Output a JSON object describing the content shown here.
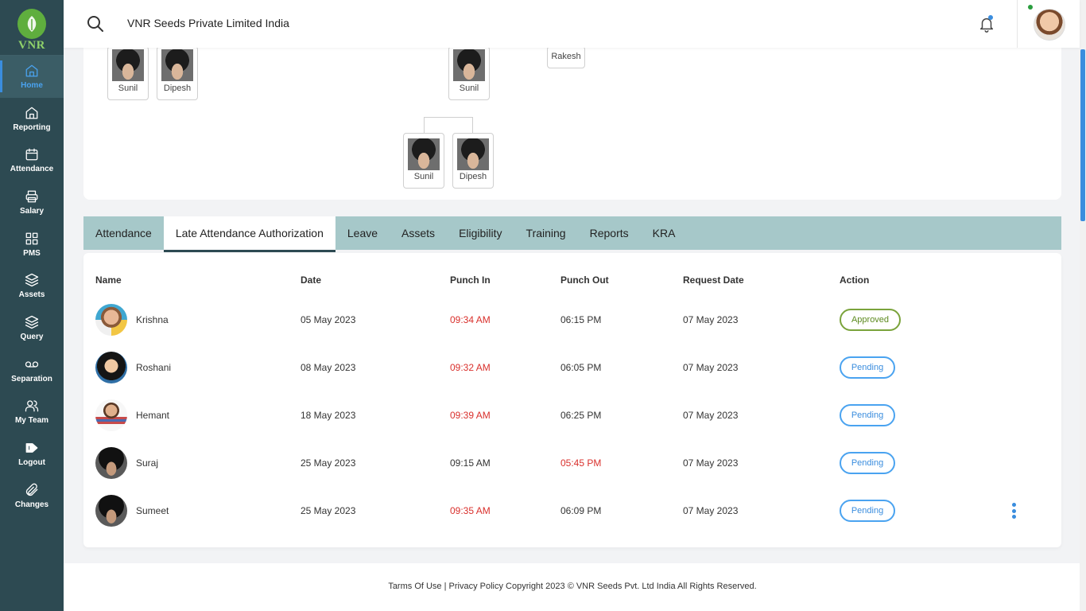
{
  "brand": {
    "logo_text": "VNR"
  },
  "sidebar": {
    "items": [
      {
        "label": "Home",
        "icon": "home-icon"
      },
      {
        "label": "Reporting",
        "icon": "home-icon"
      },
      {
        "label": "Attendance",
        "icon": "calendar-icon"
      },
      {
        "label": "Salary",
        "icon": "printer-icon"
      },
      {
        "label": "PMS",
        "icon": "grid-icon"
      },
      {
        "label": "Assets",
        "icon": "layers-icon"
      },
      {
        "label": "Query",
        "icon": "layers-icon"
      },
      {
        "label": "Separation",
        "icon": "voicemail-icon"
      },
      {
        "label": "My Team",
        "icon": "users-icon"
      },
      {
        "label": "Logout",
        "icon": "logout-icon"
      },
      {
        "label": "Changes",
        "icon": "paperclip-icon"
      }
    ]
  },
  "header": {
    "company": "VNR Seeds Private Limited India"
  },
  "org_chart": {
    "nodes": [
      "Sunil",
      "Dipesh",
      "Sunil",
      "Rakesh",
      "Sunil",
      "Dipesh"
    ]
  },
  "tabs": [
    "Attendance",
    "Late Attendance Authorization",
    "Leave",
    "Assets",
    "Eligibility",
    "Training",
    "Reports",
    "KRA"
  ],
  "table": {
    "headers": [
      "Name",
      "Date",
      "Punch In",
      "Punch Out",
      "Request Date",
      "Action"
    ],
    "rows": [
      {
        "name": "Krishna",
        "date": "05 May 2023",
        "punch_in": "09:34 AM",
        "punch_out": "06:15 PM",
        "request_date": "07 May 2023",
        "status": "Approved"
      },
      {
        "name": "Roshani",
        "date": "08 May 2023",
        "punch_in": "09:32 AM",
        "punch_out": "06:05 PM",
        "request_date": "07 May 2023",
        "status": "Pending"
      },
      {
        "name": "Hemant",
        "date": "18 May 2023",
        "punch_in": "09:39 AM",
        "punch_out": "06:25 PM",
        "request_date": "07 May 2023",
        "status": "Pending"
      },
      {
        "name": "Suraj",
        "date": "25 May 2023",
        "punch_in": "09:15 AM",
        "punch_out": "05:45 PM",
        "request_date": "07 May 2023",
        "status": "Pending"
      },
      {
        "name": "Sumeet",
        "date": "25 May 2023",
        "punch_in": "09:35 AM",
        "punch_out": "06:09 PM",
        "request_date": "07 May 2023",
        "status": "Pending"
      }
    ]
  },
  "footer": {
    "text": "Tarms Of Use | Privacy Policy Copyright 2023 © VNR Seeds Pvt. Ltd India All Rights Reserved."
  },
  "colors": {
    "sidebar": "#2d4a52",
    "tab_bar": "#a6c8c9",
    "accent": "#3a8dde",
    "late": "#d9302c",
    "approved": "#7aa33b"
  }
}
